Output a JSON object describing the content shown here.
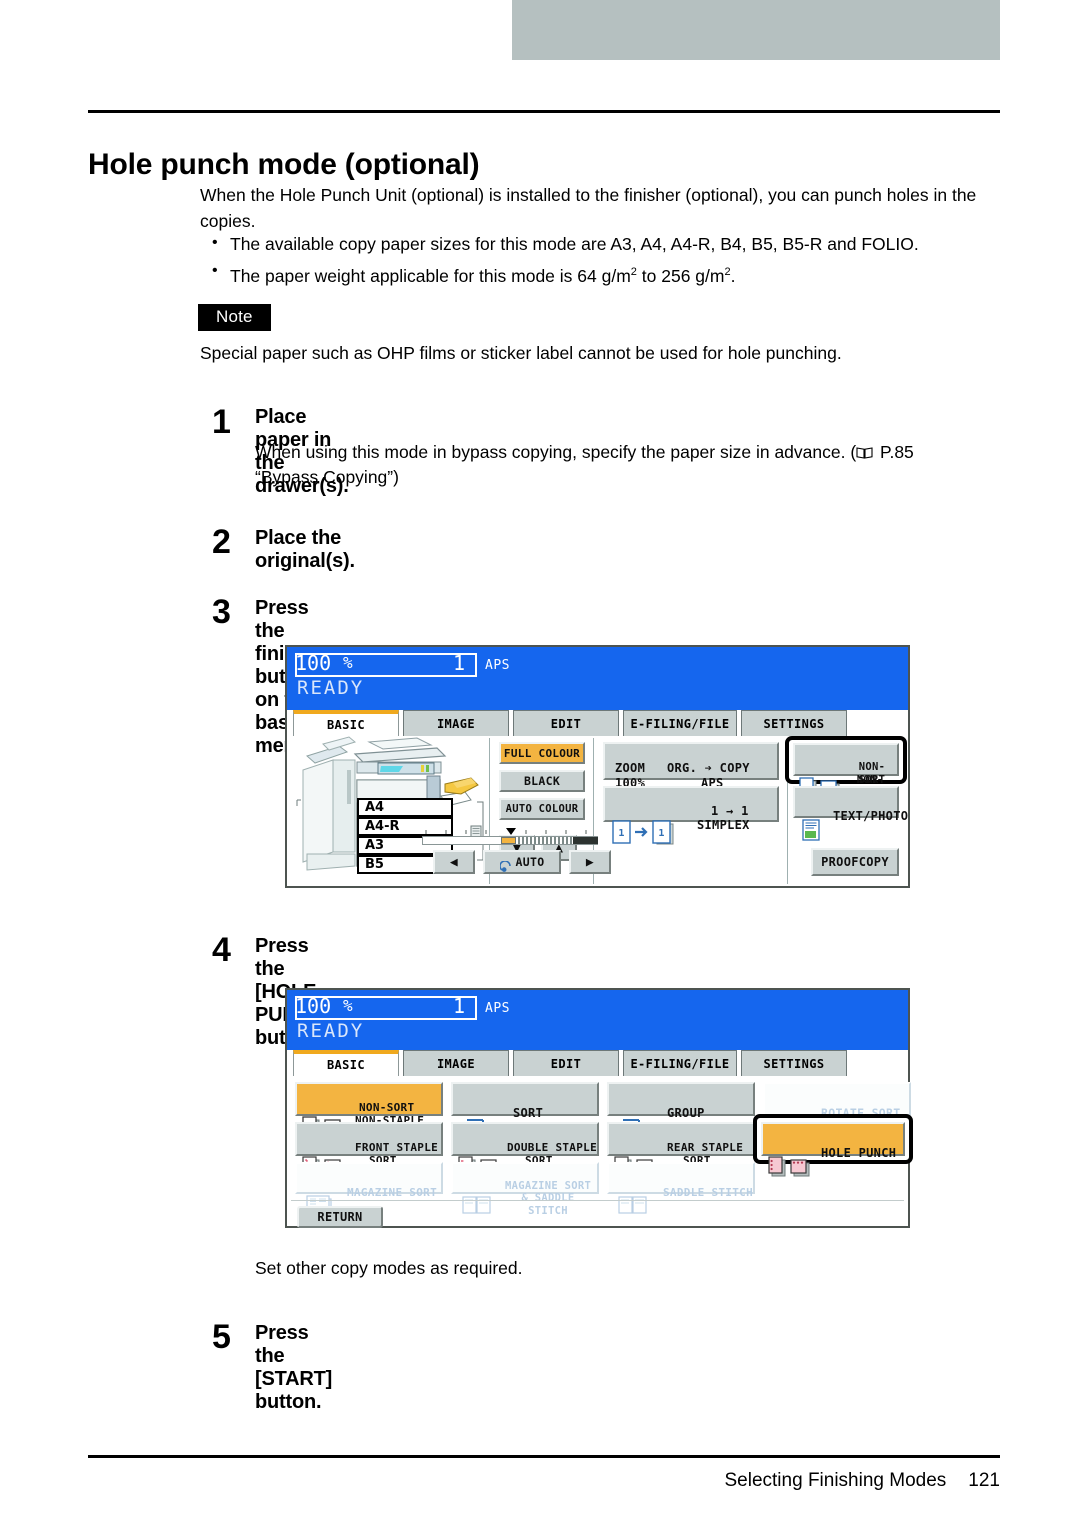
{
  "document": {
    "heading": "Hole punch mode (optional)",
    "intro": "When the Hole Punch Unit (optional) is installed to the finisher (optional), you can punch holes in the copies.",
    "bullets": [
      "The available copy paper sizes for this mode are A3, A4, A4-R, B4, B5, B5-R and FOLIO.",
      "The paper weight applicable for this mode is 64 g/m2 to 256 g/m2."
    ],
    "bullet2_parts": {
      "a": "The paper weight applicable for this mode is 64 g/m",
      "sup1": "2",
      "b": " to 256 g/m",
      "sup2": "2",
      "c": "."
    },
    "note_label": "Note",
    "note_text": "Special paper such as OHP films or sticker label cannot be used for hole punching.",
    "steps": [
      {
        "num": "1",
        "title": "Place paper in the drawer(s).",
        "body_a": "When using this mode in bypass copying, specify the paper size in advance. (",
        "body_b": " P.85",
        "body_c": "“Bypass Copying”)"
      },
      {
        "num": "2",
        "title": "Place the original(s)."
      },
      {
        "num": "3",
        "title": "Press the finisher button on the basic menu."
      },
      {
        "num": "4",
        "title": "Press the [HOLE PUNCH] button."
      },
      {
        "num": "5",
        "title": "Press the [START] button."
      }
    ],
    "interstitial": "Set other copy modes as required.",
    "footer": {
      "title": "Selecting Finishing Modes",
      "page": "121"
    },
    "colors": {
      "panel_blue": "#1566ee",
      "selected_orange": "#f3b441",
      "button_grey": "#c9d2d2",
      "header_grey": "#b5c0c0",
      "tab_accent": "#f0a91e",
      "disabled_text": "#b9cfe4"
    }
  },
  "panel1": {
    "status": {
      "zoom": "100",
      "percent": "%",
      "copies": "1",
      "paper_mode": "APS",
      "state": "READY"
    },
    "tabs": [
      {
        "label": "BASIC",
        "active": true
      },
      {
        "label": "IMAGE",
        "active": false
      },
      {
        "label": "EDIT",
        "active": false
      },
      {
        "label": "E-FILING/FILE",
        "active": false
      },
      {
        "label": "SETTINGS",
        "active": false
      }
    ],
    "paper_sizes": [
      "A4",
      "A4-R",
      "A3",
      "B5"
    ],
    "colour_buttons": [
      {
        "label": "FULL COLOUR",
        "selected": true
      },
      {
        "label": "BLACK",
        "selected": false
      },
      {
        "label": "AUTO COLOUR",
        "selected": false
      }
    ],
    "zoom_button": {
      "line1_left": "ZOOM",
      "line1_right": "ORG. ➔ COPY",
      "line2_left": "100%",
      "line2_right": "APS"
    },
    "duplex_button": {
      "line1": "1 → 1",
      "line2": "SIMPLEX"
    },
    "finisher_button": {
      "line1": "NON-SORT",
      "line2": "NON-STAPLE",
      "highlighted": true
    },
    "original_mode_button": {
      "label": "TEXT/PHOTO"
    },
    "exposure": {
      "auto_label": "AUTO",
      "left_arrow": "◀",
      "right_arrow": "▶"
    },
    "proof_button": {
      "line1": "PROOF",
      "line2": "COPY"
    },
    "updown": {
      "down": "▼",
      "up": "▲"
    }
  },
  "panel2": {
    "status": {
      "zoom": "100",
      "percent": "%",
      "copies": "1",
      "paper_mode": "APS",
      "state": "READY"
    },
    "tabs": [
      {
        "label": "BASIC",
        "active": true
      },
      {
        "label": "IMAGE",
        "active": false
      },
      {
        "label": "EDIT",
        "active": false
      },
      {
        "label": "E-FILING/FILE",
        "active": false
      },
      {
        "label": "SETTINGS",
        "active": false
      }
    ],
    "finishing_modes": [
      {
        "line1": "NON-SORT",
        "line2": "NON-STAPLE",
        "state": "selected"
      },
      {
        "line1": "SORT",
        "line2": "",
        "state": "normal"
      },
      {
        "line1": "GROUP",
        "line2": "",
        "state": "normal"
      },
      {
        "line1": "ROTATE SORT",
        "line2": "",
        "state": "disabled"
      },
      {
        "line1": "FRONT STAPLE",
        "line2": "SORT",
        "state": "normal"
      },
      {
        "line1": "DOUBLE STAPLE",
        "line2": "SORT",
        "state": "normal"
      },
      {
        "line1": "REAR  STAPLE",
        "line2": "SORT",
        "state": "normal"
      },
      {
        "line1": "HOLE PUNCH",
        "line2": "",
        "state": "selected-highlight"
      },
      {
        "line1": "MAGAZINE SORT",
        "line2": "",
        "state": "disabled"
      },
      {
        "line1": "MAGAZINE SORT",
        "line2": "& SADDLE STITCH",
        "state": "disabled"
      },
      {
        "line1": "SADDLE  STITCH",
        "line2": "",
        "state": "disabled"
      }
    ],
    "return_button": "RETURN"
  }
}
